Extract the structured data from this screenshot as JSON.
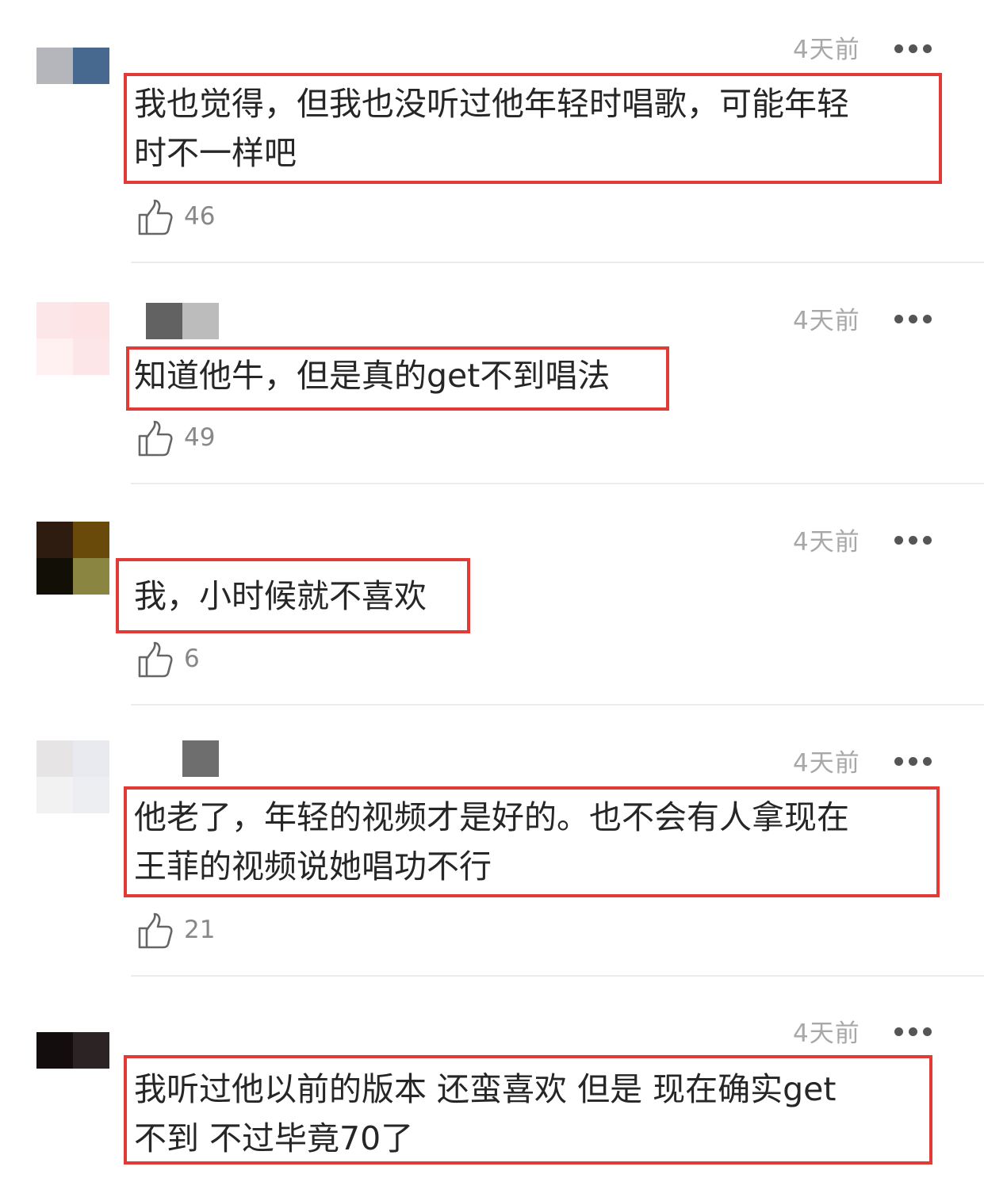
{
  "comments": [
    {
      "time": "4天前",
      "lines": [
        "我也觉得，但我也没听过他年轻时唱歌，可能年轻",
        "时不一样吧"
      ],
      "likes": "46"
    },
    {
      "time": "4天前",
      "lines": [
        "知道他牛，但是真的get不到唱法"
      ],
      "likes": "49"
    },
    {
      "time": "4天前",
      "lines": [
        "我，小时候就不喜欢"
      ],
      "likes": "6"
    },
    {
      "time": "4天前",
      "lines": [
        "他老了，年轻的视频才是好的。也不会有人拿现在",
        "王菲的视频说她唱功不行"
      ],
      "likes": "21"
    },
    {
      "time": "4天前",
      "lines": [
        "我听过他以前的版本 还蛮喜欢  但是 现在确实get",
        "不到  不过毕竟70了"
      ],
      "likes": ""
    }
  ],
  "icons": {
    "like": "thumbs-up-icon",
    "more": "more-dots-icon",
    "avatar": "pixelated-avatar"
  },
  "colors": {
    "highlight_box": "#e23a35",
    "meta_text": "#a8a8a8",
    "body_text": "#262626"
  }
}
